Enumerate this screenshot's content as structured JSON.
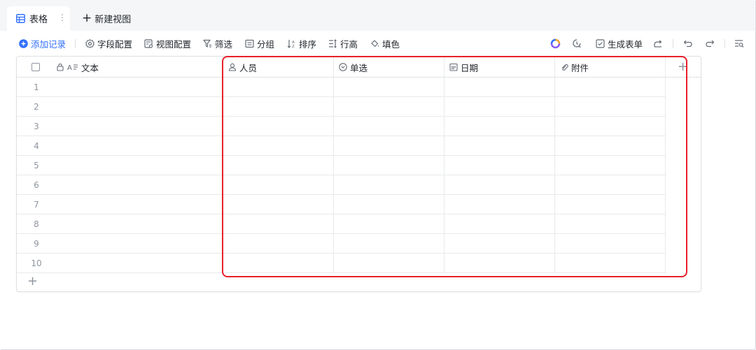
{
  "tabs": {
    "active_label": "表格",
    "more_label": "⋮",
    "new_label": "新建视图"
  },
  "toolbar": {
    "add_record": "添加记录",
    "field_config": "字段配置",
    "view_config": "视图配置",
    "filter": "筛选",
    "group": "分组",
    "sort": "排序",
    "row_height": "行高",
    "fill_color": "填色",
    "generate_form": "生成表单"
  },
  "grid": {
    "columns": [
      {
        "name": "文本",
        "icon": "text-icon"
      },
      {
        "name": "人员",
        "icon": "person-icon"
      },
      {
        "name": "单选",
        "icon": "single-select-icon"
      },
      {
        "name": "日期",
        "icon": "calendar-icon"
      },
      {
        "name": "附件",
        "icon": "paperclip-icon"
      }
    ],
    "rows": [
      "1",
      "2",
      "3",
      "4",
      "5",
      "6",
      "7",
      "8",
      "9",
      "10"
    ]
  },
  "colors": {
    "accent": "#3370ff",
    "highlight": "#e8202a",
    "border": "#dee0e3",
    "muted": "#8f959e"
  }
}
